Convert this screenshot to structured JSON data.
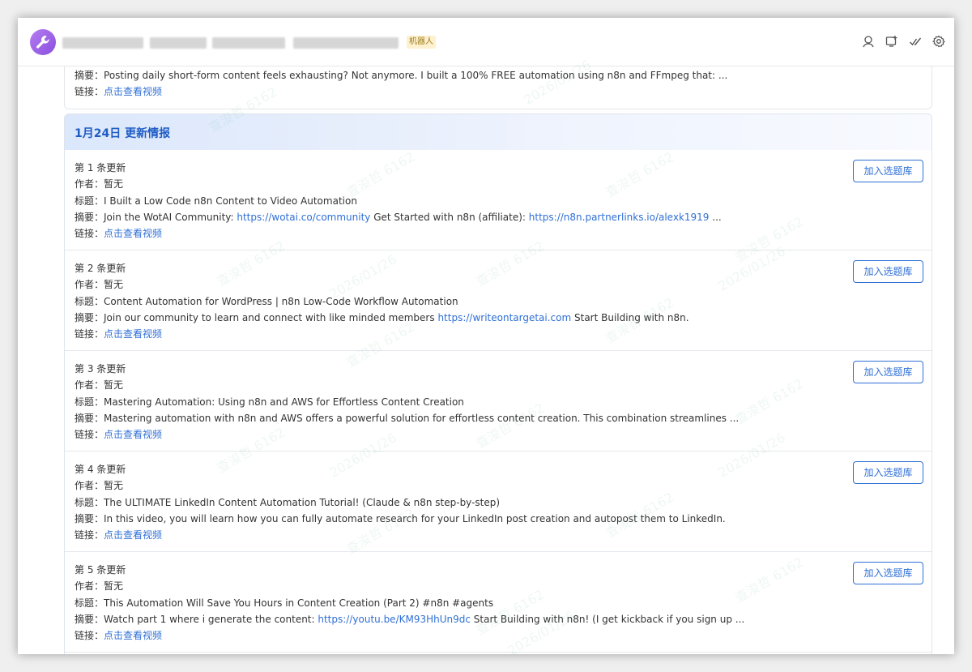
{
  "header": {
    "badge": "机器人",
    "icons": [
      "search-user-icon",
      "add-screen-icon",
      "check-icon",
      "gear-icon"
    ]
  },
  "prev_item": {
    "summary_label": "摘要：",
    "summary": "Posting daily short-form content feels exhausting? Not anymore. I built a 100% FREE automation using n8n and FFmpeg that: ...",
    "link_label": "链接：",
    "link_text": "点击查看视频"
  },
  "day": {
    "title": "1月24日 更新情报",
    "button_label": "加入选题库",
    "labels": {
      "author": "作者：",
      "title": "标题：",
      "summary": "摘要：",
      "link": "链接："
    },
    "items": [
      {
        "index": "第 1 条更新",
        "author": "暂无",
        "title": "I Built a Low Code n8n Content to Video Automation",
        "summary_a": "Join the WotAI Community: ",
        "summary_link1": "https://wotai.co/community",
        "summary_b": " Get Started with n8n (affiliate): ",
        "summary_link2": "https://n8n.partnerlinks.io/alexk1919",
        "summary_c": " ...",
        "link_text": "点击查看视频"
      },
      {
        "index": "第 2 条更新",
        "author": "暂无",
        "title": "Content Automation for WordPress | n8n Low-Code Workflow Automation",
        "summary_a": "Join our community to learn and connect with like minded members ",
        "summary_link1": "https://writeontargetai.com",
        "summary_b": " Start Building with n8n.",
        "summary_link2": "",
        "summary_c": "",
        "link_text": "点击查看视频"
      },
      {
        "index": "第 3 条更新",
        "author": "暂无",
        "title": "Mastering Automation: Using n8n and AWS for Effortless Content Creation",
        "summary_a": "Mastering automation with n8n and AWS offers a powerful solution for effortless content creation. This combination streamlines ...",
        "summary_link1": "",
        "summary_b": "",
        "summary_link2": "",
        "summary_c": "",
        "link_text": "点击查看视频"
      },
      {
        "index": "第 4 条更新",
        "author": "暂无",
        "title": "The ULTIMATE LinkedIn Content Automation Tutorial! (Claude & n8n step-by-step)",
        "summary_a": "In this video, you will learn how you can fully automate research for your LinkedIn post creation and autopost them to LinkedIn.",
        "summary_link1": "",
        "summary_b": "",
        "summary_link2": "",
        "summary_c": "",
        "link_text": "点击查看视频"
      },
      {
        "index": "第 5 条更新",
        "author": "暂无",
        "title": "This Automation Will Save You Hours in Content Creation (Part 2) #n8n #agents",
        "summary_a": "Watch part 1 where i generate the content: ",
        "summary_link1": "https://youtu.be/KM93HhUn9dc",
        "summary_b": " Start Building with n8n! (I get kickback if you sign up ...",
        "summary_link2": "",
        "summary_c": "",
        "link_text": "点击查看视频"
      }
    ]
  },
  "watermark": {
    "name": "查浚哲 6162",
    "date": "2026/01/26"
  }
}
